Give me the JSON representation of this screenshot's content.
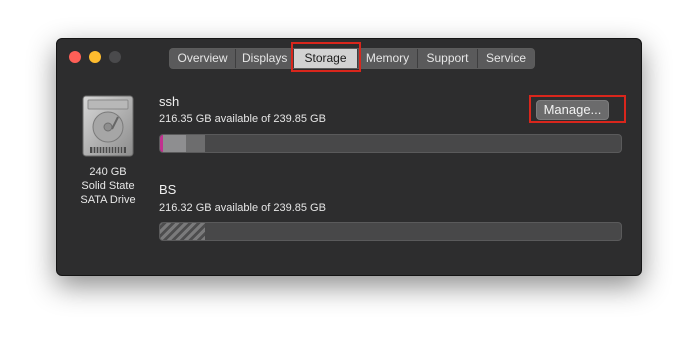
{
  "window": {
    "tabs": [
      {
        "label": "Overview"
      },
      {
        "label": "Displays"
      },
      {
        "label": "Storage",
        "selected": true
      },
      {
        "label": "Memory"
      },
      {
        "label": "Support"
      },
      {
        "label": "Service"
      }
    ]
  },
  "drive": {
    "icon": "hard-drive-icon",
    "capacity": "240 GB",
    "type": "Solid State",
    "interface": "SATA Drive"
  },
  "volumes": [
    {
      "name": "ssh",
      "availability": "216.35 GB available of 239.85 GB",
      "used_fraction": 0.098
    },
    {
      "name": "BS",
      "availability": "216.32 GB available of 239.85 GB",
      "used_fraction": 0.098
    }
  ],
  "manage_button": {
    "label": "Manage..."
  },
  "colors": {
    "window_bg": "#2d2d2e",
    "highlight": "#d9261c",
    "close": "#fe5f57",
    "minimize": "#febc2e",
    "used_accent": "#c2308f"
  }
}
